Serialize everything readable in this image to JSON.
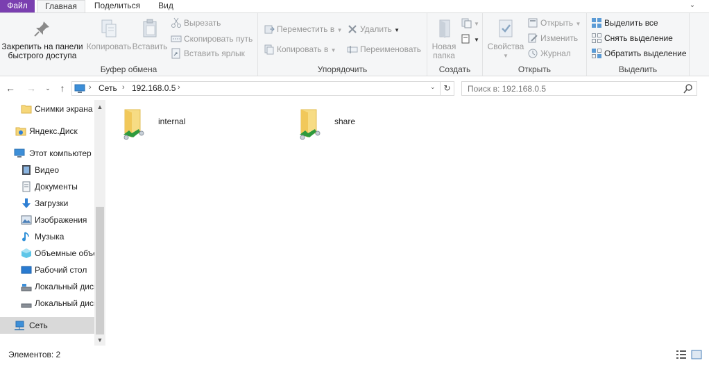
{
  "tabs": {
    "file": "Файл",
    "home": "Главная",
    "share": "Поделиться",
    "view": "Вид"
  },
  "ribbon": {
    "clipboard": {
      "label": "Буфер обмена",
      "pin_line1": "Закрепить на панели",
      "pin_line2": "быстрого доступа",
      "copy": "Копировать",
      "paste": "Вставить",
      "cut": "Вырезать",
      "copy_path": "Скопировать путь",
      "paste_shortcut": "Вставить ярлык"
    },
    "organize": {
      "label": "Упорядочить",
      "move_to": "Переместить в",
      "copy_to": "Копировать в",
      "delete": "Удалить",
      "rename": "Переименовать"
    },
    "new": {
      "label": "Создать",
      "new_folder_line1": "Новая",
      "new_folder_line2": "папка"
    },
    "open": {
      "label": "Открыть",
      "properties": "Свойства",
      "open": "Открыть",
      "edit": "Изменить",
      "history": "Журнал"
    },
    "select": {
      "label": "Выделить",
      "select_all": "Выделить все",
      "select_none": "Снять выделение",
      "invert": "Обратить выделение"
    }
  },
  "address": {
    "segments": [
      "Сеть",
      "192.168.0.5"
    ],
    "search_placeholder": "Поиск в: 192.168.0.5"
  },
  "nav": {
    "items": [
      {
        "label": "Снимки экрана",
        "icon": "folder-icon"
      },
      {
        "label": "Яндекс.Диск",
        "icon": "yandex-disk-icon"
      },
      {
        "label": "Этот компьютер",
        "icon": "computer-icon"
      },
      {
        "label": "Видео",
        "icon": "video-icon"
      },
      {
        "label": "Документы",
        "icon": "documents-icon"
      },
      {
        "label": "Загрузки",
        "icon": "downloads-icon"
      },
      {
        "label": "Изображения",
        "icon": "pictures-icon"
      },
      {
        "label": "Музыка",
        "icon": "music-icon"
      },
      {
        "label": "Объемные объекты",
        "icon": "3d-objects-icon"
      },
      {
        "label": "Рабочий стол",
        "icon": "desktop-icon"
      },
      {
        "label": "Локальный диск (C:)",
        "icon": "drive-icon"
      },
      {
        "label": "Локальный диск (D:)",
        "icon": "drive-icon"
      },
      {
        "label": "Сеть",
        "icon": "network-icon"
      }
    ]
  },
  "content": {
    "items": [
      {
        "name": "internal",
        "icon": "shared-folder-icon"
      },
      {
        "name": "share",
        "icon": "shared-folder-icon"
      }
    ]
  },
  "status": {
    "count_text": "Элементов: 2"
  },
  "colors": {
    "file_tab": "#7a3fb0",
    "selection": "#d9d9d9",
    "ribbon_bg": "#f5f6f7"
  }
}
